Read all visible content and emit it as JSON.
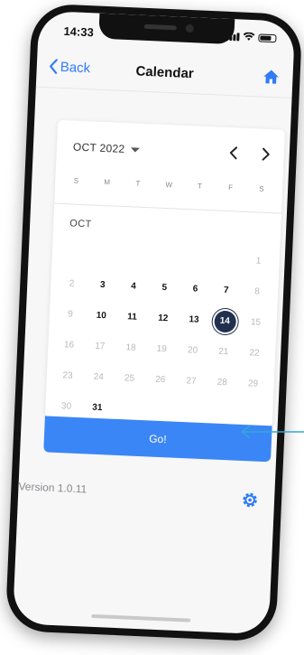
{
  "status_bar": {
    "time": "14:33"
  },
  "nav": {
    "back_label": "Back",
    "title": "Calendar",
    "home_icon": "home-icon"
  },
  "calendar": {
    "month_select": "OCT 2022",
    "weekdays": [
      "S",
      "M",
      "T",
      "W",
      "T",
      "F",
      "S"
    ],
    "month_label": "OCT",
    "weeks": [
      [
        {
          "d": ""
        },
        {
          "d": ""
        },
        {
          "d": ""
        },
        {
          "d": ""
        },
        {
          "d": ""
        },
        {
          "d": ""
        },
        {
          "d": "1",
          "s": "muted"
        }
      ],
      [
        {
          "d": "2",
          "s": "muted"
        },
        {
          "d": "3",
          "s": "bold"
        },
        {
          "d": "4",
          "s": "bold"
        },
        {
          "d": "5",
          "s": "bold"
        },
        {
          "d": "6",
          "s": "bold"
        },
        {
          "d": "7",
          "s": "bold"
        },
        {
          "d": "8",
          "s": "muted"
        }
      ],
      [
        {
          "d": "9",
          "s": "muted"
        },
        {
          "d": "10",
          "s": "bold"
        },
        {
          "d": "11",
          "s": "bold"
        },
        {
          "d": "12",
          "s": "bold"
        },
        {
          "d": "13",
          "s": "bold"
        },
        {
          "d": "14",
          "s": "selected"
        },
        {
          "d": "15",
          "s": "muted"
        }
      ],
      [
        {
          "d": "16",
          "s": "muted"
        },
        {
          "d": "17",
          "s": "muted"
        },
        {
          "d": "18",
          "s": "muted"
        },
        {
          "d": "19",
          "s": "muted"
        },
        {
          "d": "20",
          "s": "muted"
        },
        {
          "d": "21",
          "s": "muted"
        },
        {
          "d": "22",
          "s": "muted"
        }
      ],
      [
        {
          "d": "23",
          "s": "muted"
        },
        {
          "d": "24",
          "s": "muted"
        },
        {
          "d": "25",
          "s": "muted"
        },
        {
          "d": "26",
          "s": "muted"
        },
        {
          "d": "27",
          "s": "muted"
        },
        {
          "d": "28",
          "s": "muted"
        },
        {
          "d": "29",
          "s": "muted"
        }
      ],
      [
        {
          "d": "30",
          "s": "muted"
        },
        {
          "d": "31",
          "s": "bold"
        },
        {
          "d": ""
        },
        {
          "d": ""
        },
        {
          "d": ""
        },
        {
          "d": ""
        },
        {
          "d": ""
        }
      ]
    ],
    "selected_day": "14"
  },
  "go_button": {
    "label": "Go!"
  },
  "footer": {
    "version": "Version 1.0.11",
    "settings_icon": "gear-icon"
  },
  "colors": {
    "accent": "#3b86f6",
    "selected_day_bg": "#22304f",
    "back_link": "#2f7cf6"
  }
}
